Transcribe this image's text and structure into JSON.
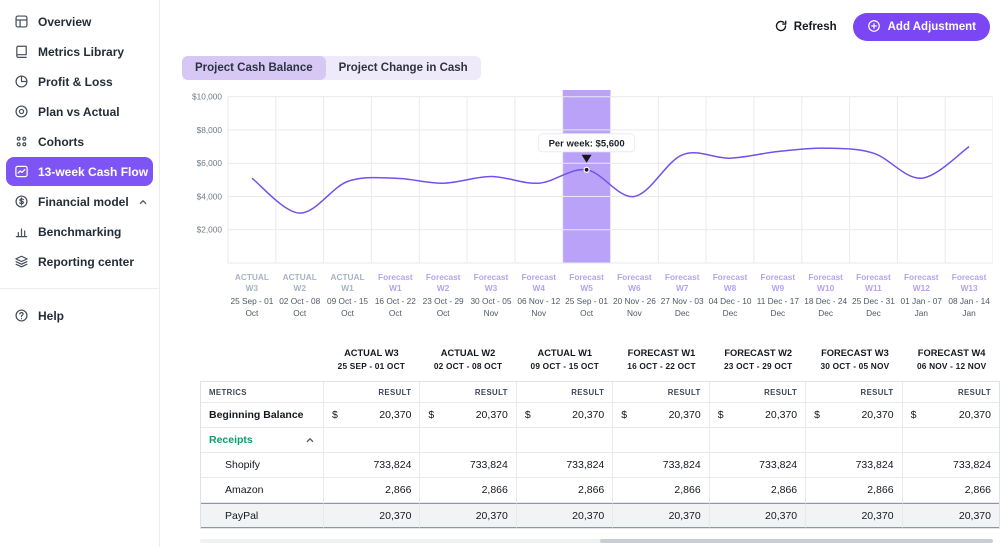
{
  "sidebar": {
    "items": [
      {
        "label": "Overview",
        "icon": "overview-icon",
        "active": false
      },
      {
        "label": "Metrics Library",
        "icon": "metrics-library-icon",
        "active": false
      },
      {
        "label": "Profit & Loss",
        "icon": "profit-loss-icon",
        "active": false
      },
      {
        "label": "Plan vs Actual",
        "icon": "plan-vs-actual-icon",
        "active": false
      },
      {
        "label": "Cohorts",
        "icon": "cohorts-icon",
        "active": false
      },
      {
        "label": "13-week Cash Flow",
        "icon": "cash-flow-icon",
        "active": true
      },
      {
        "label": "Financial model",
        "icon": "financial-model-icon",
        "active": false,
        "chevron": "up"
      },
      {
        "label": "Benchmarking",
        "icon": "benchmarking-icon",
        "active": false
      },
      {
        "label": "Reporting center",
        "icon": "reporting-center-icon",
        "active": false
      }
    ],
    "help": {
      "label": "Help"
    }
  },
  "toolbar": {
    "refresh_label": "Refresh",
    "add_adjustment_label": "Add Adjustment"
  },
  "tabs": [
    {
      "label": "Project Cash Balance",
      "active": true
    },
    {
      "label": "Project Change in Cash",
      "active": false
    }
  ],
  "chart_data": {
    "type": "line",
    "title": "Project Cash Balance",
    "ylim": [
      0,
      10400
    ],
    "yticks": [
      10000,
      8000,
      6000,
      4000,
      2000
    ],
    "ytick_labels": [
      "$10,000",
      "$8,000",
      "$6,000",
      "$4,000",
      "$2,000"
    ],
    "grid": true,
    "line_color": "#7451e8",
    "highlight_color": "#a98bf8",
    "highlight_index": 7,
    "tooltip": {
      "label": "Per week: $5,600",
      "value": 5600
    },
    "columns": [
      {
        "label": "ACTUAL W3",
        "kind": "actual",
        "dates": "25 Sep - 01 Oct",
        "value": 5100
      },
      {
        "label": "ACTUAL W2",
        "kind": "actual",
        "dates": "02 Oct - 08 Oct",
        "value": 3000
      },
      {
        "label": "ACTUAL W1",
        "kind": "actual",
        "dates": "09 Oct - 15 Oct",
        "value": 4900
      },
      {
        "label": "Forecast W1",
        "kind": "forecast",
        "dates": "16 Oct - 22 Oct",
        "value": 5100
      },
      {
        "label": "Forecast W2",
        "kind": "forecast",
        "dates": "23 Oct - 29 Oct",
        "value": 4800
      },
      {
        "label": "Forecast W3",
        "kind": "forecast",
        "dates": "30 Oct - 05 Nov",
        "value": 5200
      },
      {
        "label": "Forecast W4",
        "kind": "forecast",
        "dates": "06 Nov - 12 Nov",
        "value": 4800
      },
      {
        "label": "Forecast W5",
        "kind": "forecast",
        "dates": "25 Sep - 01 Oct",
        "value": 5600
      },
      {
        "label": "Forecast W6",
        "kind": "forecast",
        "dates": "20 Nov - 26 Nov",
        "value": 4000
      },
      {
        "label": "Forecast W7",
        "kind": "forecast",
        "dates": "27 Nov - 03 Dec",
        "value": 6500
      },
      {
        "label": "Forecast W8",
        "kind": "forecast",
        "dates": "04 Dec - 10 Dec",
        "value": 6300
      },
      {
        "label": "Forecast W9",
        "kind": "forecast",
        "dates": "11 Dec - 17 Dec",
        "value": 6700
      },
      {
        "label": "Forecast W10",
        "kind": "forecast",
        "dates": "18 Dec - 24 Dec",
        "value": 6900
      },
      {
        "label": "Forecast W11",
        "kind": "forecast",
        "dates": "25 Dec - 31 Dec",
        "value": 6600
      },
      {
        "label": "Forecast W12",
        "kind": "forecast",
        "dates": "01 Jan - 07 Jan",
        "value": 5100
      },
      {
        "label": "Forecast W13",
        "kind": "forecast",
        "dates": "08 Jan - 14 Jan",
        "value": 7000
      }
    ]
  },
  "table": {
    "metrics_header": "METRICS",
    "result_header": "RESULT",
    "columns": [
      {
        "title": "ACTUAL W3",
        "subtitle": "25 SEP - 01 OCT"
      },
      {
        "title": "ACTUAL W2",
        "subtitle": "02 OCT - 08 OCT"
      },
      {
        "title": "ACTUAL W1",
        "subtitle": "09 OCT - 15 OCT"
      },
      {
        "title": "FORECAST W1",
        "subtitle": "16 OCT - 22 OCT"
      },
      {
        "title": "FORECAST W2",
        "subtitle": "23 OCT - 29 OCT"
      },
      {
        "title": "FORECAST W3",
        "subtitle": "30 OCT - 05 NOV"
      },
      {
        "title": "FORECAST W4",
        "subtitle": "06 NOV - 12 NOV"
      }
    ],
    "rows": [
      {
        "label": "Beginning Balance",
        "style": "bold",
        "currency": "$",
        "selected": false,
        "values": [
          "20,370",
          "20,370",
          "20,370",
          "20,370",
          "20,370",
          "20,370",
          "20,370"
        ]
      },
      {
        "label": "Receipts",
        "style": "section",
        "chevron": "up",
        "selected": false,
        "values": [
          "",
          "",
          "",
          "",
          "",
          "",
          ""
        ]
      },
      {
        "label": "Shopify",
        "style": "item",
        "selected": false,
        "values": [
          "733,824",
          "733,824",
          "733,824",
          "733,824",
          "733,824",
          "733,824",
          "733,824"
        ]
      },
      {
        "label": "Amazon",
        "style": "item",
        "selected": false,
        "values": [
          "2,866",
          "2,866",
          "2,866",
          "2,866",
          "2,866",
          "2,866",
          "2,866"
        ]
      },
      {
        "label": "PayPal",
        "style": "item",
        "selected": true,
        "values": [
          "20,370",
          "20,370",
          "20,370",
          "20,370",
          "20,370",
          "20,370",
          "20,370"
        ]
      }
    ]
  }
}
